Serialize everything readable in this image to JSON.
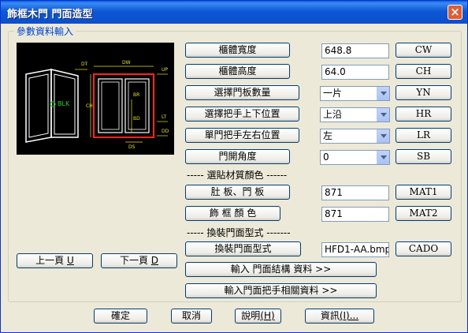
{
  "window": {
    "title": "飾框木門 門面造型",
    "close_label": "×"
  },
  "group": {
    "label": "參數資料輸入"
  },
  "preview": {
    "labels": {
      "dt": "DT",
      "dw": "DW",
      "up": "UP",
      "ch": "CH",
      "blk": "BLK",
      "br": "BR",
      "bd": "BD",
      "lt": "LT",
      "dd": "DD",
      "ds": "DS"
    }
  },
  "fields": [
    {
      "label": "櫃體寬度",
      "value": "648.8",
      "code": "CW"
    },
    {
      "label": "櫃體高度",
      "value": "64.0",
      "code": "CH"
    },
    {
      "label": "選擇門板數量",
      "value": "一片",
      "code": "YN"
    },
    {
      "label": "選擇把手上下位置",
      "value": "上沿",
      "code": "HR"
    },
    {
      "label": "單門把手左右位置",
      "value": "左",
      "code": "LR"
    },
    {
      "label": "門開角度",
      "value": "0",
      "code": "SB"
    }
  ],
  "material_section": "----- 選貼材質顏色 ------",
  "materials": [
    {
      "label": "肚 板、門 板",
      "value": "871",
      "code": "MAT1"
    },
    {
      "label": "飾 框 顏 色",
      "value": "871",
      "code": "MAT2"
    }
  ],
  "style_section": "----- 換裝門面型式 -------",
  "style": {
    "label": "換裝門面型式",
    "value": "HFD1-AA.bmp",
    "code": "CADO"
  },
  "wide_buttons": {
    "structure": "輸入 門面結構 資料 >>",
    "handle": "輸入門面把手相關資料 >>"
  },
  "nav": {
    "prev": "上一頁",
    "prev_key": "U",
    "next": "下一頁",
    "next_key": "D"
  },
  "bottom": {
    "ok": "確定",
    "cancel": "取消",
    "help": "說明",
    "help_key": "(H)",
    "info": "資訊",
    "info_key": "(I)..."
  },
  "colors": {
    "title_bar": "#0b4fcc",
    "dialog_bg": "#ece9d8",
    "group_label": "#0046d5",
    "cad_line": "#ffffff",
    "cad_accent": "#ff2020",
    "cad_dim": "#e6e600",
    "cad_highlight": "#00e000"
  }
}
